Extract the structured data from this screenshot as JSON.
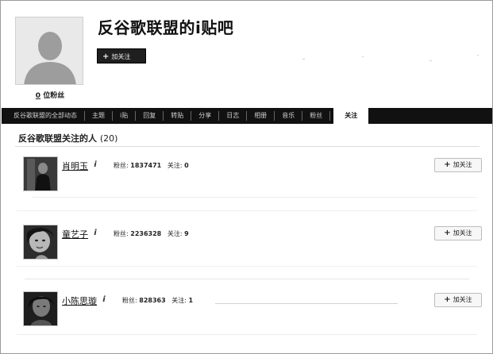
{
  "profile": {
    "title": "反谷歌联盟的i贴吧",
    "follow_label": "加关注",
    "fans_count": "0",
    "fans_label": "位粉丝"
  },
  "nav": {
    "items": [
      "反谷歌联盟的全部动态",
      "主题",
      "i贴",
      "回复",
      "转贴",
      "分享",
      "日志",
      "相册",
      "音乐",
      "粉丝"
    ],
    "active": "关注"
  },
  "section": {
    "title": "反谷歌联盟关注的人",
    "count": "(20)"
  },
  "stats_labels": {
    "fans": "粉丝:",
    "following": "关注:"
  },
  "users": [
    {
      "name": "肖明玉",
      "info_icon": "i",
      "fans": "1837471",
      "following": "0",
      "follow_label": "加关注"
    },
    {
      "name": "童艺子",
      "info_icon": "i",
      "fans": "2236328",
      "following": "9",
      "follow_label": "加关注"
    },
    {
      "name": "小陈思璇",
      "info_icon": "i",
      "fans": "828363",
      "following": "1",
      "follow_label": "加关注"
    }
  ]
}
